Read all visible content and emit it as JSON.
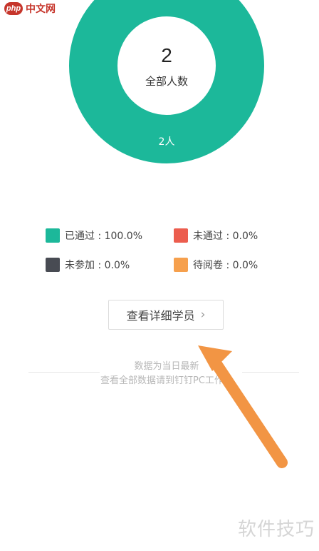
{
  "watermark_top": {
    "logo_text": "php",
    "site_text": "中文网"
  },
  "chart": {
    "center_number": "2",
    "center_label": "全部人数",
    "slice_label": "2人",
    "colors": {
      "passed": "#1cb89a",
      "failed": "#ec5d4e",
      "absent": "#484b53",
      "pending": "#f6a04d"
    }
  },
  "chart_data": {
    "type": "pie",
    "title": "",
    "categories": [
      "已通过",
      "未通过",
      "未参加",
      "待阅卷"
    ],
    "values": [
      100.0,
      0.0,
      0.0,
      0.0
    ],
    "total": 2,
    "legend_placement": "bottom"
  },
  "legend": {
    "items": [
      {
        "label": "已通过 : 100.0%",
        "color": "#1cb89a"
      },
      {
        "label": "未通过 : 0.0%",
        "color": "#ec5d4e"
      },
      {
        "label": "未参加 : 0.0%",
        "color": "#484b53"
      },
      {
        "label": "待阅卷 : 0.0%",
        "color": "#f6a04d"
      }
    ]
  },
  "detail_button": {
    "label": "查看详细学员"
  },
  "notes": {
    "line1": "数据为当日最新",
    "line2": "查看全部数据请到钉钉PC工作台"
  },
  "watermark_bottom": {
    "text": "软件技巧"
  },
  "arrow_color": "#f29544"
}
